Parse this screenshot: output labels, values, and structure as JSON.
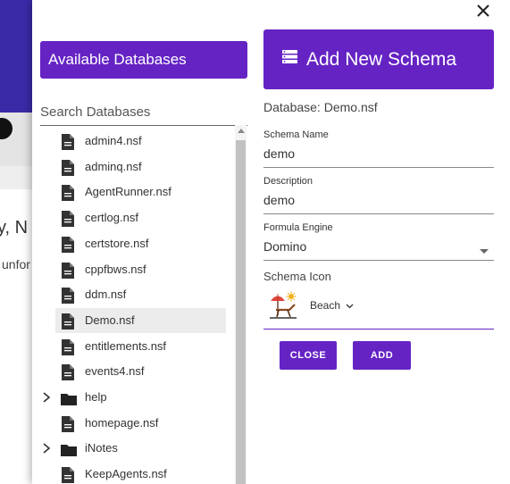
{
  "background": {
    "title_fragment": "y, N",
    "sub_fragment": "unfor"
  },
  "dialog": {
    "available_header": "Available Databases",
    "search_placeholder": "Search Databases",
    "tree": [
      {
        "label": "admin4.nsf",
        "kind": "file",
        "selected": false
      },
      {
        "label": "adminq.nsf",
        "kind": "file",
        "selected": false
      },
      {
        "label": "AgentRunner.nsf",
        "kind": "file",
        "selected": false
      },
      {
        "label": "certlog.nsf",
        "kind": "file",
        "selected": false
      },
      {
        "label": "certstore.nsf",
        "kind": "file",
        "selected": false
      },
      {
        "label": "cppfbws.nsf",
        "kind": "file",
        "selected": false
      },
      {
        "label": "ddm.nsf",
        "kind": "file",
        "selected": false
      },
      {
        "label": "Demo.nsf",
        "kind": "file",
        "selected": true
      },
      {
        "label": "entitlements.nsf",
        "kind": "file",
        "selected": false
      },
      {
        "label": "events4.nsf",
        "kind": "file",
        "selected": false
      },
      {
        "label": "help",
        "kind": "folder",
        "selected": false
      },
      {
        "label": "homepage.nsf",
        "kind": "file",
        "selected": false
      },
      {
        "label": "iNotes",
        "kind": "folder",
        "selected": false
      },
      {
        "label": "KeepAgents.nsf",
        "kind": "file",
        "selected": false
      }
    ],
    "schema_header": "Add New Schema",
    "database_label": "Database: Demo.nsf",
    "schema_name": {
      "label": "Schema Name",
      "value": "demo"
    },
    "description": {
      "label": "Description",
      "value": "demo"
    },
    "formula_engine": {
      "label": "Formula Engine",
      "value": "Domino"
    },
    "schema_icon": {
      "label": "Schema Icon",
      "value": "Beach"
    },
    "buttons": {
      "close": "CLOSE",
      "add": "ADD"
    },
    "accent_color": "#6523c4"
  }
}
